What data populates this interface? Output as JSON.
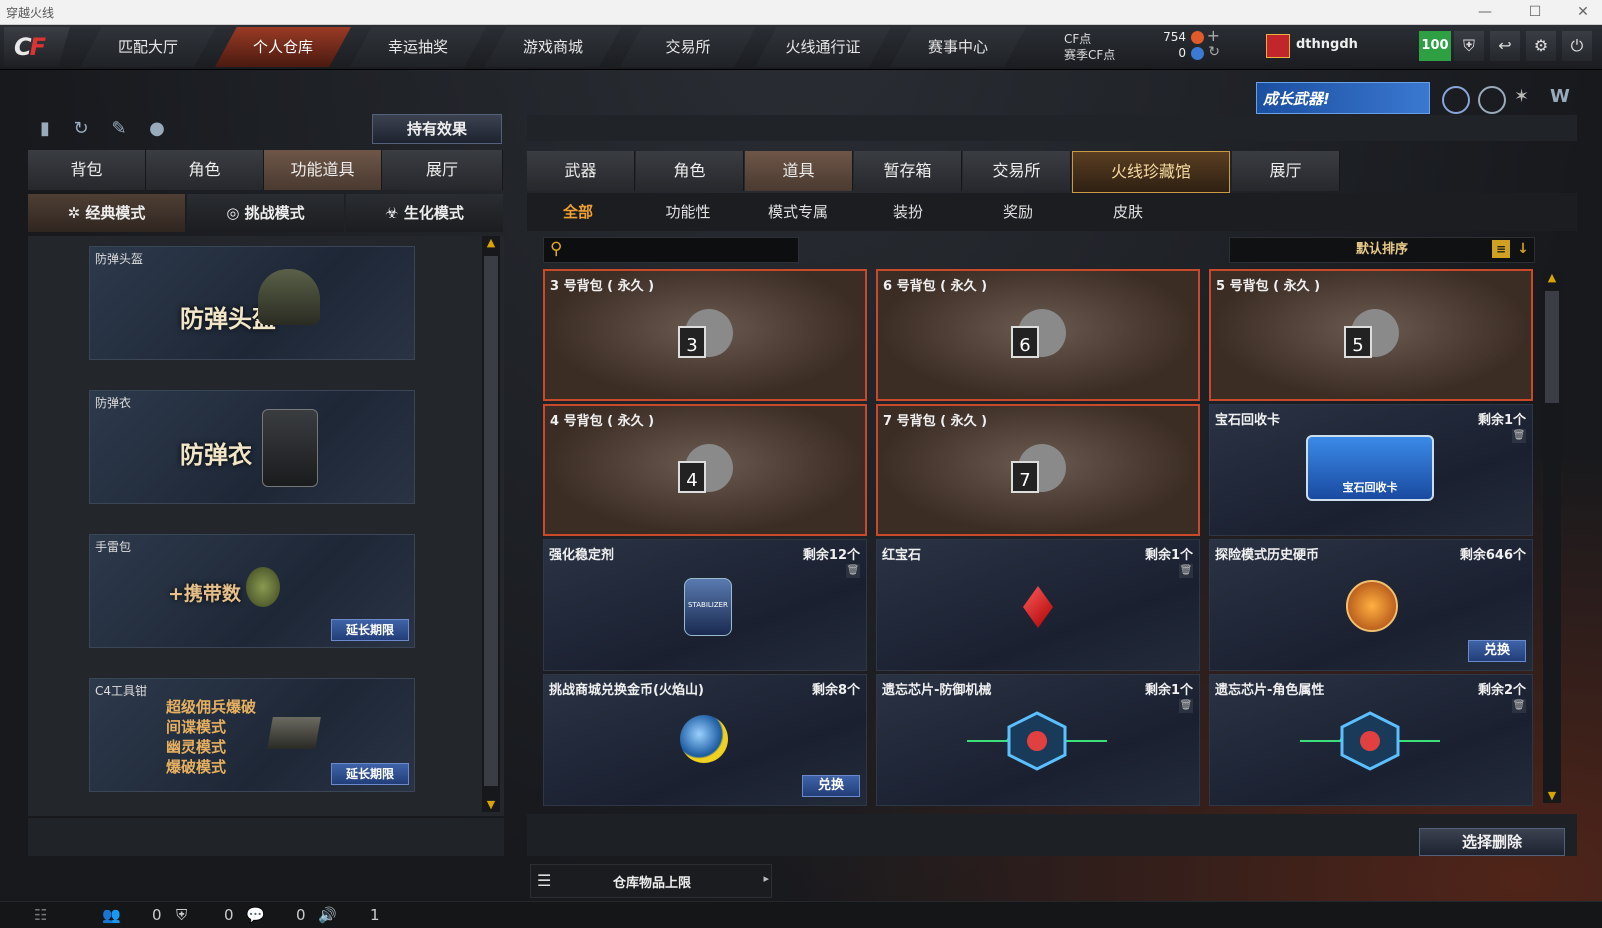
{
  "window": {
    "title": "穿越火线",
    "min": "—",
    "max": "☐",
    "close": "✕"
  },
  "logo": {
    "text": "CF"
  },
  "nav": [
    "匹配大厅",
    "个人仓库",
    "幸运抽奖",
    "游戏商城",
    "交易所",
    "火线通行证",
    "赛事中心"
  ],
  "currency": {
    "cf_label": "CF点",
    "cf_value": "754",
    "season_label": "赛季CF点",
    "season_value": "0",
    "plus": "+",
    "refresh": "↻"
  },
  "user": {
    "name": "dthngdh",
    "level": "100"
  },
  "banner": {
    "text": "成长武器!"
  },
  "left": {
    "effects_button": "持有效果",
    "tabs": [
      "背包",
      "角色",
      "功能道具",
      "展厅"
    ],
    "modes": [
      "经典模式",
      "挑战模式",
      "生化模式"
    ],
    "cards": [
      {
        "caption": "防弹头盔",
        "big": "防弹头盔"
      },
      {
        "caption": "防弹衣",
        "big": "防弹衣"
      },
      {
        "caption": "手雷包",
        "big": "+携带数",
        "extend": "延长期限"
      },
      {
        "caption": "C4工具钳",
        "lines": [
          "超级佣兵爆破",
          "间谍模式",
          "幽灵模式",
          "爆破模式"
        ],
        "extend": "延长期限"
      }
    ]
  },
  "right": {
    "tabs": [
      "武器",
      "角色",
      "道具",
      "暂存箱",
      "交易所",
      "火线珍藏馆",
      "展厅"
    ],
    "subtabs": [
      "全部",
      "功能性",
      "模式专属",
      "装扮",
      "奖励",
      "皮肤"
    ],
    "sort_label": "默认排序",
    "items": [
      {
        "name": "3 号背包 ( 永久 )",
        "bag": "3"
      },
      {
        "name": "6 号背包 ( 永久 )",
        "bag": "6"
      },
      {
        "name": "5 号背包 ( 永久 )",
        "bag": "5"
      },
      {
        "name": "4 号背包 ( 永久 )",
        "bag": "4"
      },
      {
        "name": "7 号背包 ( 永久 )",
        "bag": "7"
      },
      {
        "name": "宝石回收卡",
        "remain": "剩余1个",
        "card_text": "宝石回收卡"
      },
      {
        "name": "强化稳定剂",
        "remain": "剩余12个",
        "icon_text": "STABILIZER"
      },
      {
        "name": "红宝石",
        "remain": "剩余1个"
      },
      {
        "name": "探险模式历史硬币",
        "remain": "剩余646个",
        "exchange": "兑换"
      },
      {
        "name": "挑战商城兑换金币(火焰山)",
        "remain": "剩余8个",
        "exchange": "兑换"
      },
      {
        "name": "遗忘芯片-防御机械",
        "remain": "剩余1个"
      },
      {
        "name": "遗忘芯片-角色属性",
        "remain": "剩余2个"
      }
    ],
    "delete_button": "选择删除",
    "capacity_label": "仓库物品上限"
  },
  "status": {
    "a": "0",
    "b": "0",
    "c": "0",
    "d": "1"
  },
  "colors": {
    "accent": "#c84a2a",
    "gold": "#f0a030",
    "button_blue": "#3f63a8"
  }
}
